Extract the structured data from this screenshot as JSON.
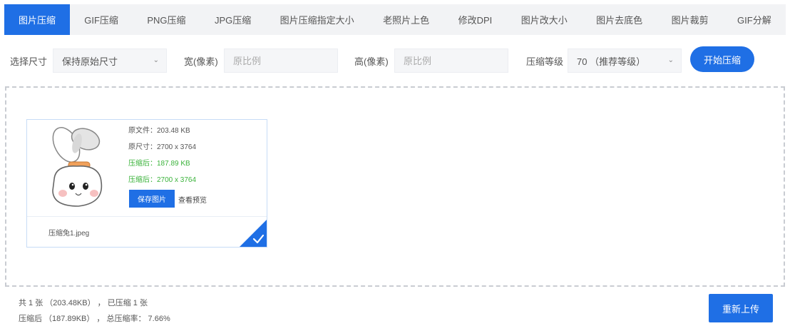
{
  "tabs": [
    {
      "label": "图片压缩",
      "active": true
    },
    {
      "label": "GIF压缩"
    },
    {
      "label": "PNG压缩"
    },
    {
      "label": "JPG压缩"
    },
    {
      "label": "图片压缩指定大小"
    },
    {
      "label": "老照片上色"
    },
    {
      "label": "修改DPI"
    },
    {
      "label": "图片改大小"
    },
    {
      "label": "图片去底色"
    },
    {
      "label": "图片裁剪"
    },
    {
      "label": "GIF分解"
    }
  ],
  "options": {
    "size_label": "选择尺寸",
    "size_value": "保持原始尺寸",
    "width_label": "宽(像素)",
    "width_placeholder": "原比例",
    "height_label": "高(像素)",
    "height_placeholder": "原比例",
    "level_label": "压缩等级",
    "level_value": "70 （推荐等级）",
    "start_label": "开始压缩"
  },
  "file": {
    "original_size": "原文件：203.48 KB",
    "original_dims": "原尺寸：2700 x 3764",
    "compressed_size": "压缩后：187.89 KB",
    "compressed_dims": "压缩后：2700 x 3764",
    "save_label": "保存图片",
    "preview_label": "查看预览",
    "name": "压缩兔1.jpeg"
  },
  "summary": {
    "line1": "共 1 张 （203.48KB） ， 已压缩 1 张",
    "line2": "压缩后 （187.89KB） ， 总压缩率： 7.66%"
  },
  "reupload_label": "重新上传",
  "colors": {
    "accent": "#1f6fe5",
    "success": "#3bb33b",
    "tab_bg": "#f2f3f5"
  }
}
